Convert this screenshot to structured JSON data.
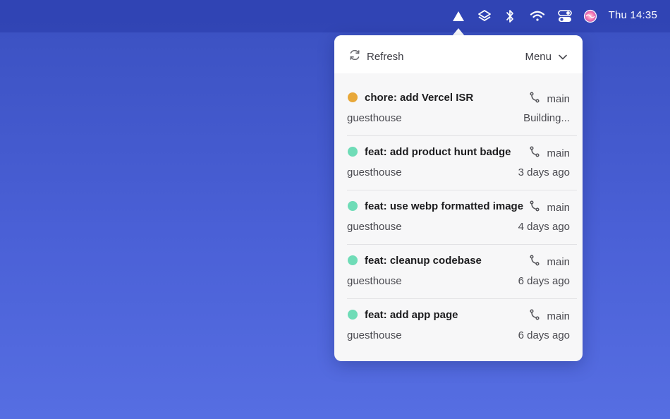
{
  "menubar": {
    "icons": [
      "vercel-triangle-icon",
      "layers-icon",
      "bluetooth-icon",
      "wifi-icon",
      "control-center-icon",
      "siri-icon"
    ],
    "clock": "Thu 14:35"
  },
  "panel": {
    "refresh_label": "Refresh",
    "menu_label": "Menu"
  },
  "deployments": [
    {
      "commit": "chore: add Vercel ISR",
      "branch": "main",
      "project": "guesthouse",
      "status": "Building...",
      "state_color": "#e8a83a"
    },
    {
      "commit": "feat: add product hunt badge",
      "branch": "main",
      "project": "guesthouse",
      "status": "3 days ago",
      "state_color": "#6fdcb7"
    },
    {
      "commit": "feat: use webp formatted image",
      "branch": "main",
      "project": "guesthouse",
      "status": "4 days ago",
      "state_color": "#6fdcb7"
    },
    {
      "commit": "feat: cleanup codebase",
      "branch": "main",
      "project": "guesthouse",
      "status": "6 days ago",
      "state_color": "#6fdcb7"
    },
    {
      "commit": "feat: add app page",
      "branch": "main",
      "project": "guesthouse",
      "status": "6 days ago",
      "state_color": "#6fdcb7"
    }
  ]
}
